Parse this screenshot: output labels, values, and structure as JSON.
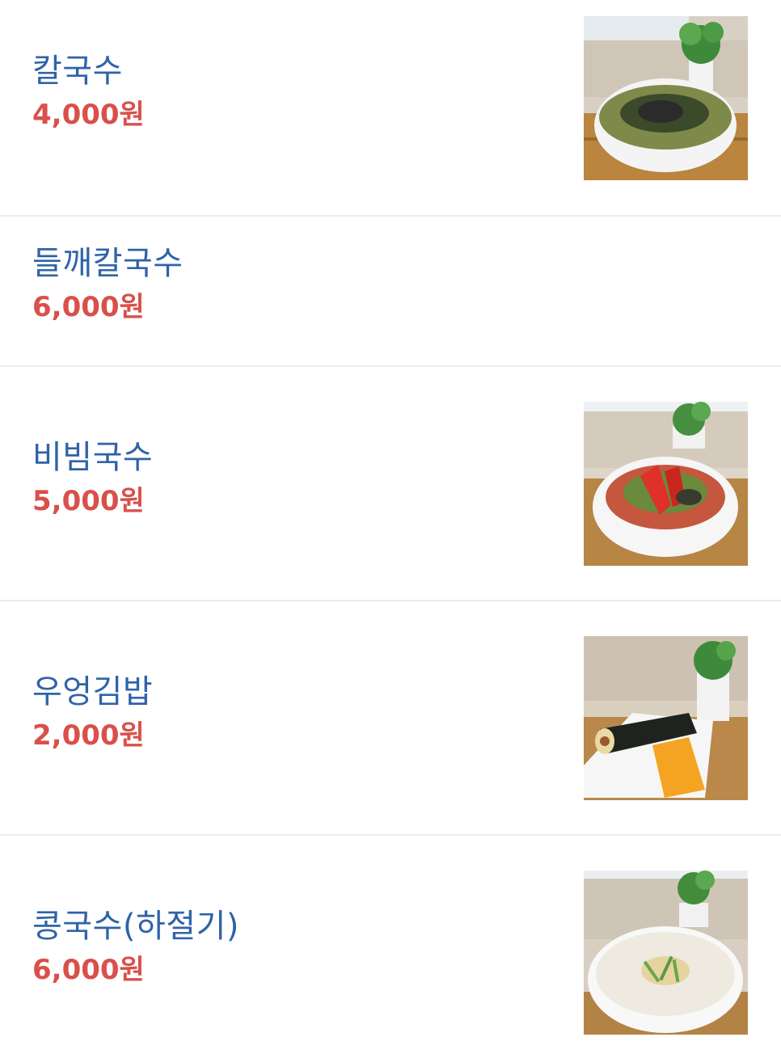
{
  "menu": {
    "items": [
      {
        "name": "칼국수",
        "price": "4,000원",
        "photo": "bowl-kalguksu"
      },
      {
        "name": "들깨칼국수",
        "price": "6,000원",
        "photo": ""
      },
      {
        "name": "비빔국수",
        "price": "5,000원",
        "photo": "bowl-bibimguksu"
      },
      {
        "name": "우엉김밥",
        "price": "2,000원",
        "photo": "plate-gimbap"
      },
      {
        "name": "콩국수(하절기)",
        "price": "6,000원",
        "photo": "bowl-kongguksu"
      }
    ]
  },
  "colors": {
    "name_text": "#2f63a8",
    "price_text": "#d9504a",
    "divider": "#ececec"
  }
}
